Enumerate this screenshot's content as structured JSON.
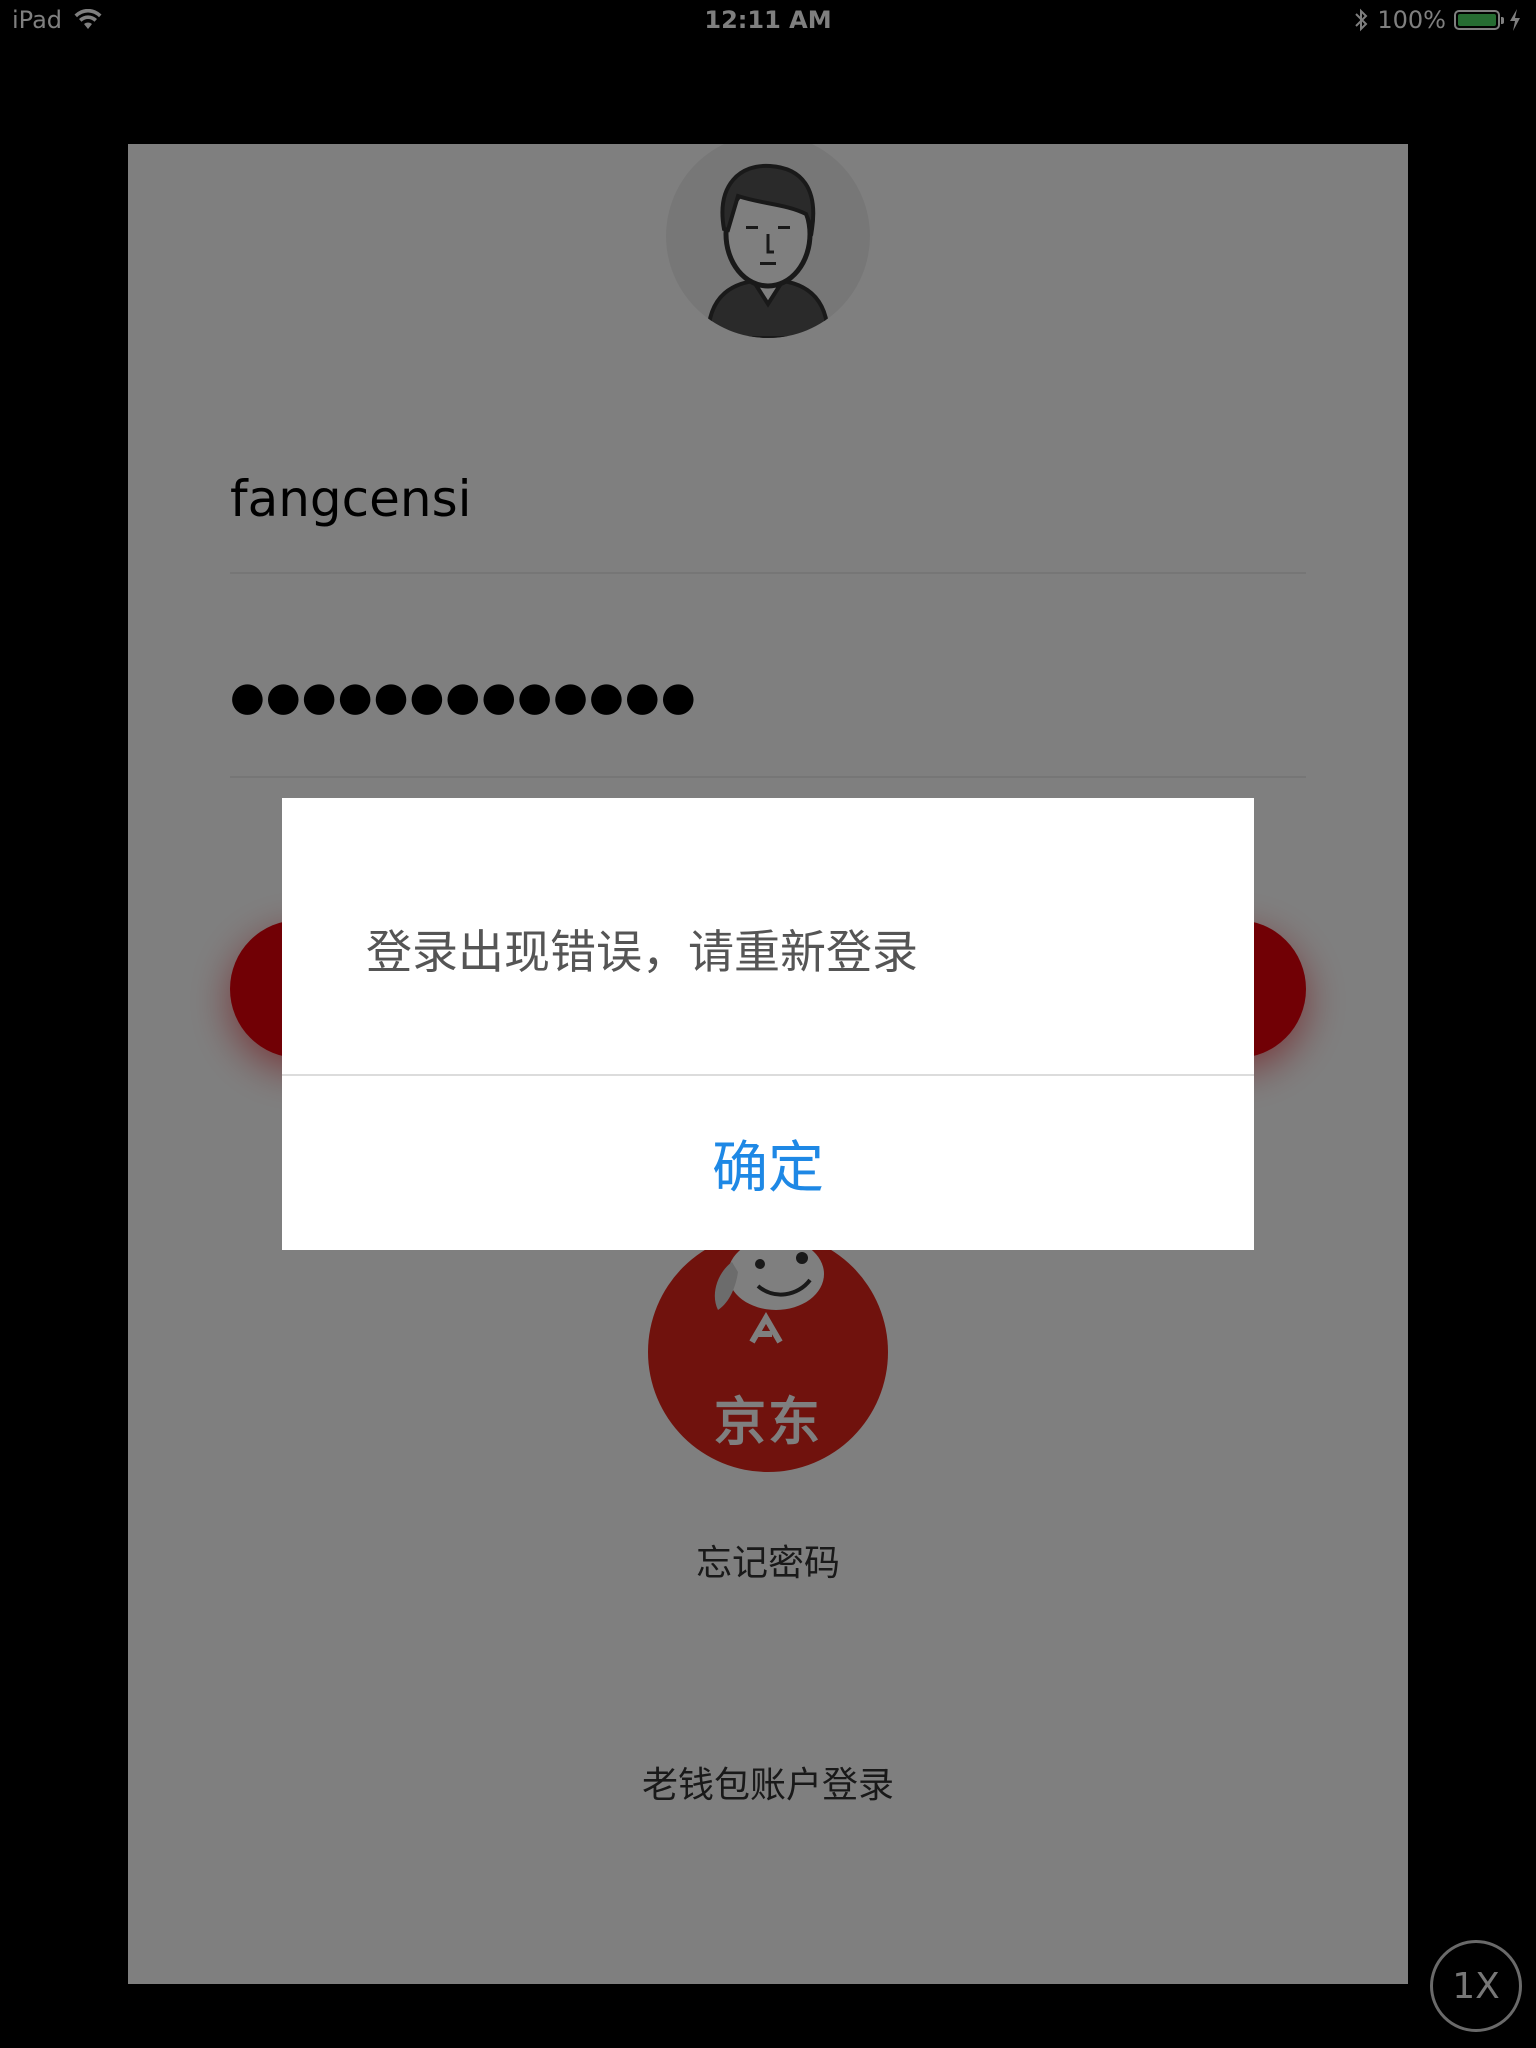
{
  "status_bar": {
    "device": "iPad",
    "time": "12:11 AM",
    "battery_percent": "100%",
    "battery_level": 1.0,
    "battery_color": "#4cd964"
  },
  "login": {
    "username": "fangcensi",
    "password_mask": "●●●●●●●●●●●●●",
    "brand_logo_text": "京东",
    "forgot_password": "忘记密码",
    "old_wallet_login": "老钱包账户登录",
    "accent_color": "#e3000b"
  },
  "alert": {
    "message": "登录出现错误，请重新登录",
    "confirm_label": "确定",
    "confirm_color": "#1e88e5"
  },
  "zoom_badge": "1X"
}
